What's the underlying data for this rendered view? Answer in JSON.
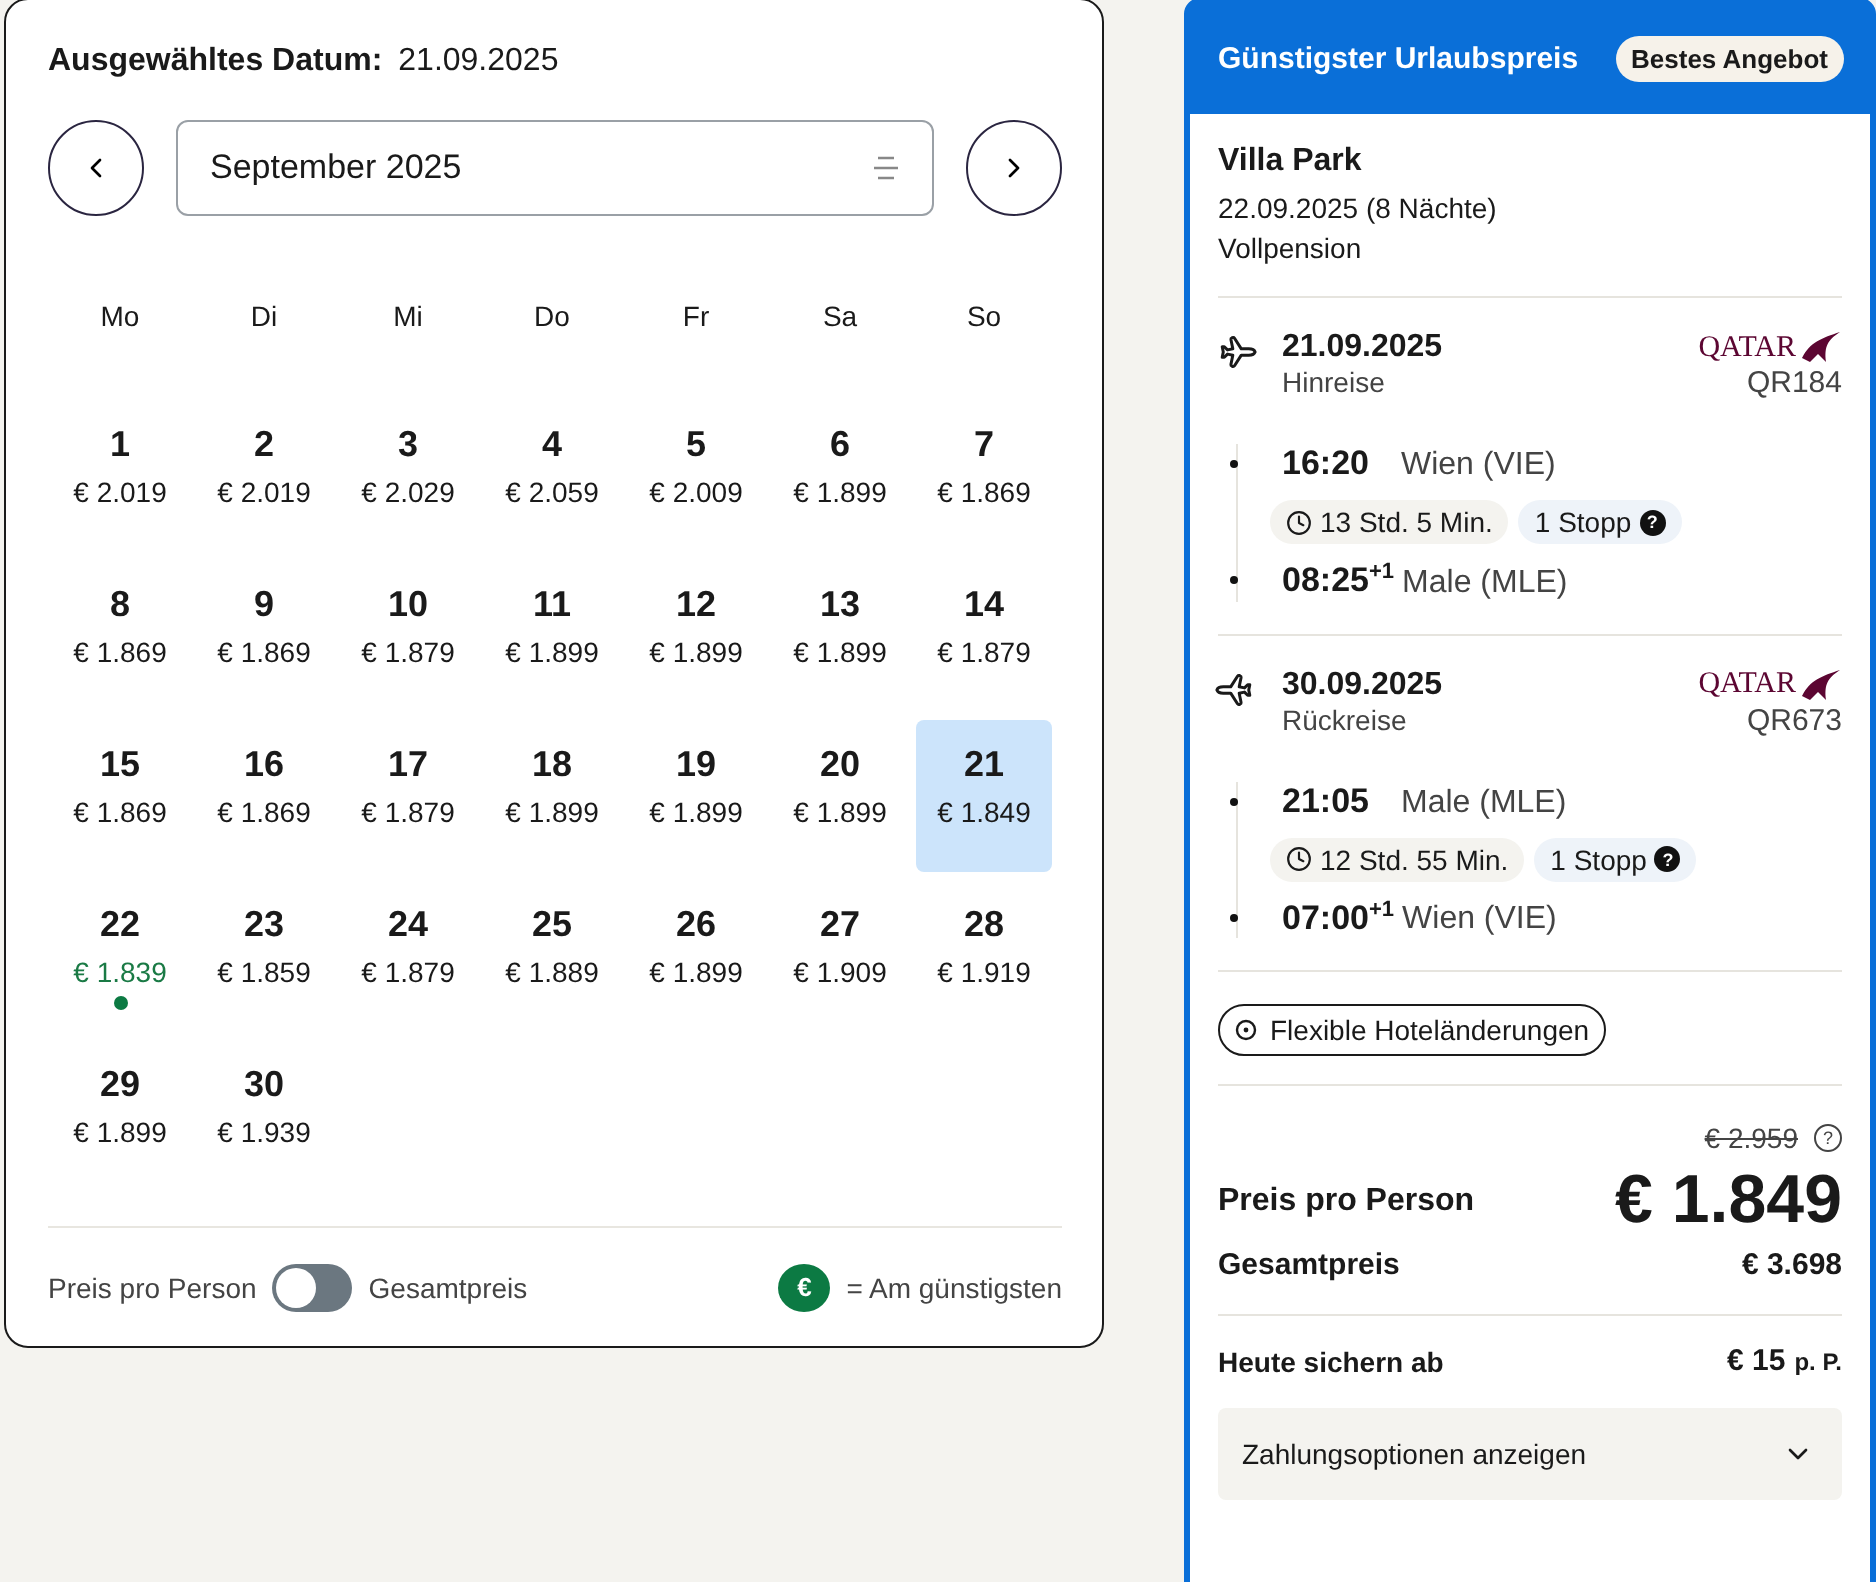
{
  "calendar": {
    "selected_label": "Ausgewähltes Datum:",
    "selected_value": "21.09.2025",
    "month": "September 2025",
    "weekdays": [
      "Mo",
      "Di",
      "Mi",
      "Do",
      "Fr",
      "Sa",
      "So"
    ],
    "days": [
      {
        "day": "1",
        "price": "€ 2.019",
        "selected": false,
        "cheapest": false
      },
      {
        "day": "2",
        "price": "€ 2.019",
        "selected": false,
        "cheapest": false
      },
      {
        "day": "3",
        "price": "€ 2.029",
        "selected": false,
        "cheapest": false
      },
      {
        "day": "4",
        "price": "€ 2.059",
        "selected": false,
        "cheapest": false
      },
      {
        "day": "5",
        "price": "€ 2.009",
        "selected": false,
        "cheapest": false
      },
      {
        "day": "6",
        "price": "€ 1.899",
        "selected": false,
        "cheapest": false
      },
      {
        "day": "7",
        "price": "€ 1.869",
        "selected": false,
        "cheapest": false
      },
      {
        "day": "8",
        "price": "€ 1.869",
        "selected": false,
        "cheapest": false
      },
      {
        "day": "9",
        "price": "€ 1.869",
        "selected": false,
        "cheapest": false
      },
      {
        "day": "10",
        "price": "€ 1.879",
        "selected": false,
        "cheapest": false
      },
      {
        "day": "11",
        "price": "€ 1.899",
        "selected": false,
        "cheapest": false
      },
      {
        "day": "12",
        "price": "€ 1.899",
        "selected": false,
        "cheapest": false
      },
      {
        "day": "13",
        "price": "€ 1.899",
        "selected": false,
        "cheapest": false
      },
      {
        "day": "14",
        "price": "€ 1.879",
        "selected": false,
        "cheapest": false
      },
      {
        "day": "15",
        "price": "€ 1.869",
        "selected": false,
        "cheapest": false
      },
      {
        "day": "16",
        "price": "€ 1.869",
        "selected": false,
        "cheapest": false
      },
      {
        "day": "17",
        "price": "€ 1.879",
        "selected": false,
        "cheapest": false
      },
      {
        "day": "18",
        "price": "€ 1.899",
        "selected": false,
        "cheapest": false
      },
      {
        "day": "19",
        "price": "€ 1.899",
        "selected": false,
        "cheapest": false
      },
      {
        "day": "20",
        "price": "€ 1.899",
        "selected": false,
        "cheapest": false
      },
      {
        "day": "21",
        "price": "€ 1.849",
        "selected": true,
        "cheapest": false
      },
      {
        "day": "22",
        "price": "€ 1.839",
        "selected": false,
        "cheapest": true
      },
      {
        "day": "23",
        "price": "€ 1.859",
        "selected": false,
        "cheapest": false
      },
      {
        "day": "24",
        "price": "€ 1.879",
        "selected": false,
        "cheapest": false
      },
      {
        "day": "25",
        "price": "€ 1.889",
        "selected": false,
        "cheapest": false
      },
      {
        "day": "26",
        "price": "€ 1.899",
        "selected": false,
        "cheapest": false
      },
      {
        "day": "27",
        "price": "€ 1.909",
        "selected": false,
        "cheapest": false
      },
      {
        "day": "28",
        "price": "€ 1.919",
        "selected": false,
        "cheapest": false
      },
      {
        "day": "29",
        "price": "€ 1.899",
        "selected": false,
        "cheapest": false
      },
      {
        "day": "30",
        "price": "€ 1.939",
        "selected": false,
        "cheapest": false
      }
    ],
    "toggle": {
      "left_label": "Preis pro Person",
      "right_label": "Gesamtpreis",
      "on": false
    },
    "legend": {
      "symbol": "€",
      "label": "= Am günstigsten"
    }
  },
  "offer": {
    "title": "Günstigster Urlaubspreis",
    "badge": "Bestes Angebot",
    "hotel": "Villa Park",
    "dates": "22.09.2025 (8 Nächte)",
    "board": "Vollpension",
    "legs": [
      {
        "kind": "outbound",
        "date": "21.09.2025",
        "label": "Hinreise",
        "airline": "QATAR",
        "flight": "QR184",
        "dep_time": "16:20",
        "dep_place": "Wien (VIE)",
        "duration": "13 Std. 5 Min.",
        "stops": "1 Stopp",
        "stops_help": "?",
        "arr_time": "08:25",
        "arr_plus": "+1",
        "arr_place": "Male (MLE)"
      },
      {
        "kind": "return",
        "date": "30.09.2025",
        "label": "Rückreise",
        "airline": "QATAR",
        "flight": "QR673",
        "dep_time": "21:05",
        "dep_place": "Male (MLE)",
        "duration": "12 Std. 55 Min.",
        "stops": "1 Stopp",
        "stops_help": "?",
        "arr_time": "07:00",
        "arr_plus": "+1",
        "arr_place": "Wien (VIE)"
      }
    ],
    "flex_button": "Flexible Hoteländerungen",
    "old_price": "€ 2.959",
    "price_help": "?",
    "per_person_label": "Preis pro Person",
    "per_person_price": "€ 1.849",
    "total_label": "Gesamtpreis",
    "total_price": "€ 3.698",
    "deposit_label": "Heute sichern ab",
    "deposit_price": "€ 15",
    "deposit_unit": "p. P.",
    "payment_button": "Zahlungsoptionen anzeigen"
  }
}
